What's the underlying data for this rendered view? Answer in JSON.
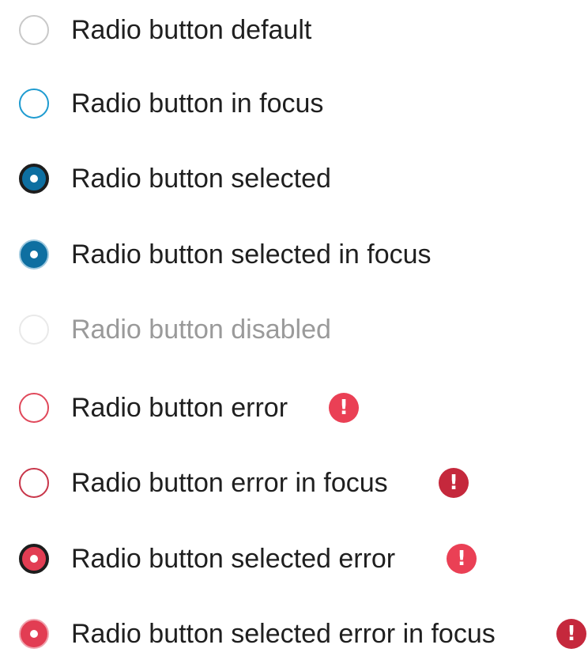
{
  "radios": [
    {
      "label": "Radio button default",
      "state": "default",
      "selected": false,
      "error": false
    },
    {
      "label": "Radio button in focus",
      "state": "focus",
      "selected": false,
      "error": false
    },
    {
      "label": "Radio button selected",
      "state": "selected",
      "selected": true,
      "error": false
    },
    {
      "label": "Radio button selected in focus",
      "state": "selected-focus",
      "selected": true,
      "error": false
    },
    {
      "label": "Radio button disabled",
      "state": "disabled",
      "selected": false,
      "error": false
    },
    {
      "label": "Radio button error",
      "state": "error",
      "selected": false,
      "error": true
    },
    {
      "label": "Radio button error in focus",
      "state": "error-focus",
      "selected": false,
      "error": true
    },
    {
      "label": "Radio button selected error",
      "state": "selected-error",
      "selected": true,
      "error": true
    },
    {
      "label": "Radio button selected error in focus",
      "state": "selected-error-focus",
      "selected": true,
      "error": true
    }
  ],
  "error_icon": {
    "glyph": "!",
    "icon": "exclamation-circle-icon"
  },
  "colors": {
    "focus_blue": "#1e9bd0",
    "selected_blue": "#0e6fa1",
    "error_red": "#e0485a",
    "error_red_dark": "#c5283c",
    "text": "#1f1f1f",
    "disabled_text": "#9a9a9a"
  }
}
